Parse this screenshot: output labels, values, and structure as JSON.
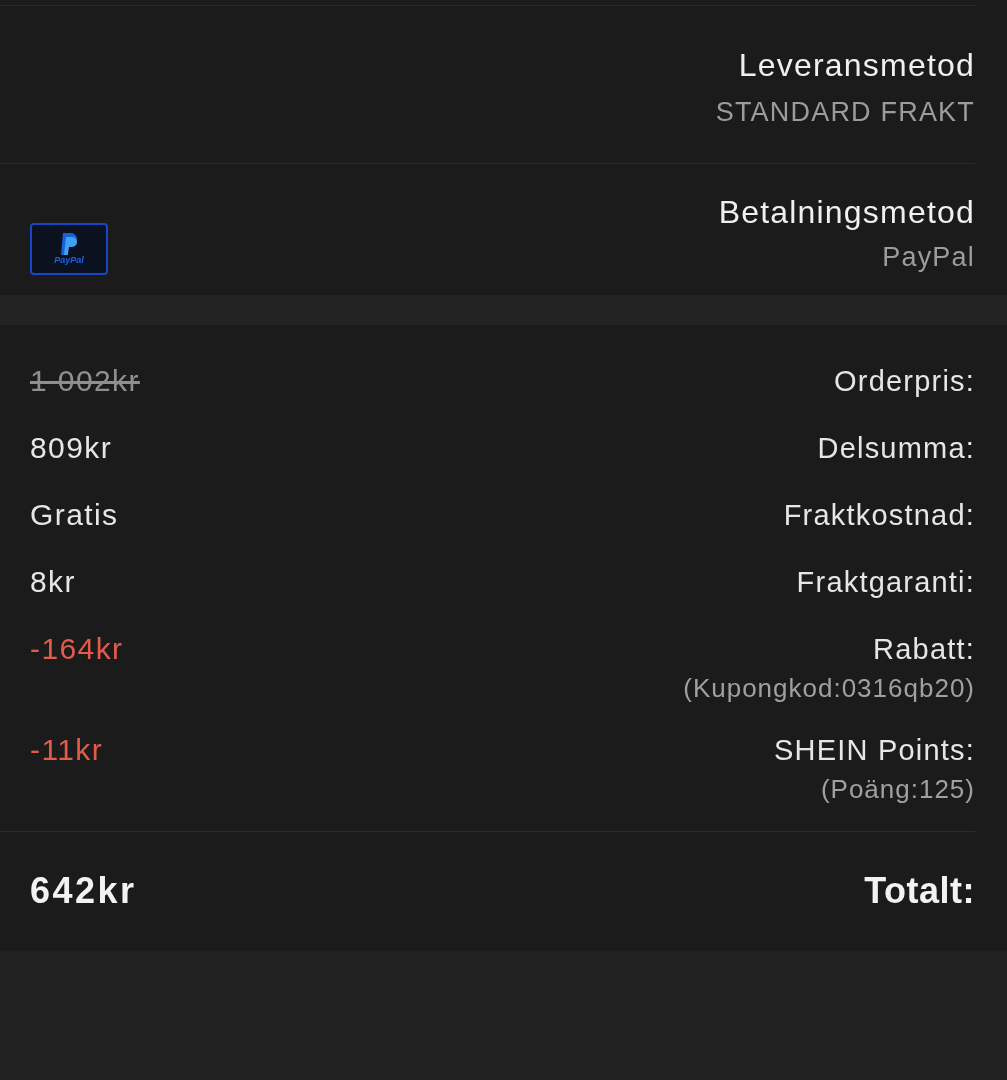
{
  "delivery": {
    "title": "Leveransmetod",
    "value": "STANDARD FRAKT"
  },
  "payment": {
    "title": "Betalningsmetod",
    "value": "PayPal",
    "logo_text": "PayPal"
  },
  "summary": [
    {
      "label": "Orderpris:",
      "value": "1 002kr",
      "kind": "struck"
    },
    {
      "label": "Delsumma:",
      "value": "809kr",
      "kind": "plain"
    },
    {
      "label": "Fraktkostnad:",
      "value": "Gratis",
      "kind": "plain"
    },
    {
      "label": "Fraktgaranti:",
      "value": "8kr",
      "kind": "plain"
    },
    {
      "label": "Rabatt:",
      "value": "-164kr",
      "kind": "discount",
      "note": "(Kupongkod:0316qb20)"
    },
    {
      "label": "SHEIN Points:",
      "value": "-11kr",
      "kind": "discount",
      "note": "(Poäng:125)"
    }
  ],
  "total": {
    "label": "Totalt:",
    "value": "642kr"
  }
}
